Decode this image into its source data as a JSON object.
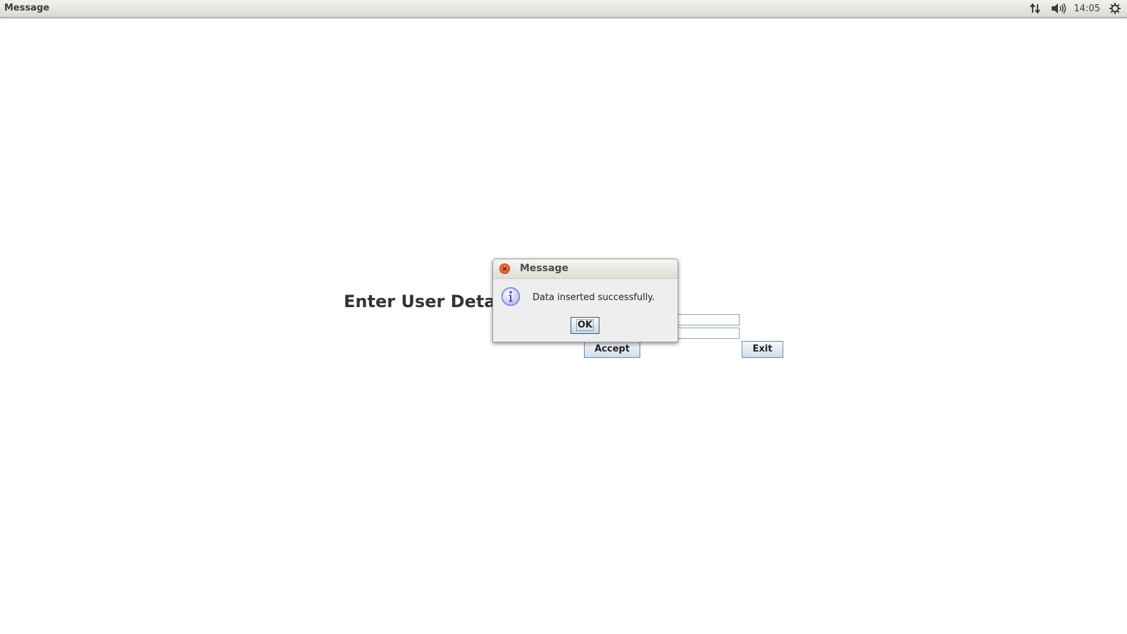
{
  "top_panel": {
    "title": "Message",
    "clock": "14:05",
    "icons": [
      "network-arrows-icon",
      "volume-icon",
      "gear-icon"
    ]
  },
  "main_window": {
    "heading": "Enter User Deta",
    "fields": [
      {
        "value": "",
        "placeholder": ""
      },
      {
        "value": "",
        "placeholder": ""
      }
    ],
    "accept_label": "Accept",
    "exit_label": "Exit"
  },
  "dialog": {
    "title": "Message",
    "message": "Data inserted successfully.",
    "ok_label": "OK",
    "icon": "info-icon"
  },
  "colors": {
    "panel_bg": "#dcdad5",
    "close_button": "#dc4a1f",
    "button_gradient_bottom": "#cfdeed",
    "info_icon": "#8f8fe0"
  }
}
